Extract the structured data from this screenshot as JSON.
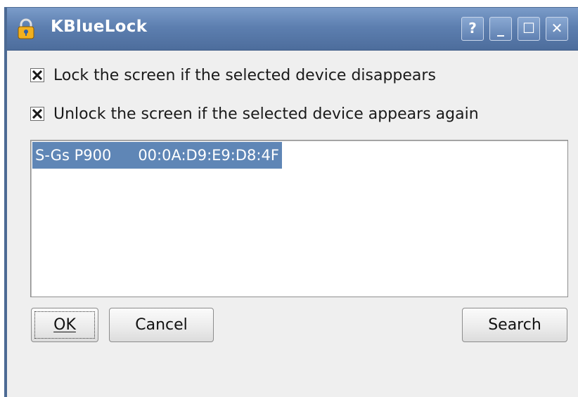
{
  "window": {
    "title": "KBlueLock",
    "app_icon": "padlock-icon",
    "titlebar_buttons": {
      "help": "?",
      "minimize": "_",
      "maximize": "☐",
      "close": "✕"
    }
  },
  "options": {
    "lock_label": "Lock the screen if the selected device disappears",
    "lock_checked": true,
    "unlock_label": "Unlock the screen if the selected device appears again",
    "unlock_checked": true
  },
  "devices": {
    "selected": {
      "name": "S-Gs P900",
      "address": "00:0A:D9:E9:D8:4F"
    }
  },
  "buttons": {
    "ok": "OK",
    "cancel": "Cancel",
    "search": "Search"
  },
  "colors": {
    "titlebar": "#5d7fb0",
    "selection": "#5f86b6",
    "window_bg": "#efefef"
  }
}
